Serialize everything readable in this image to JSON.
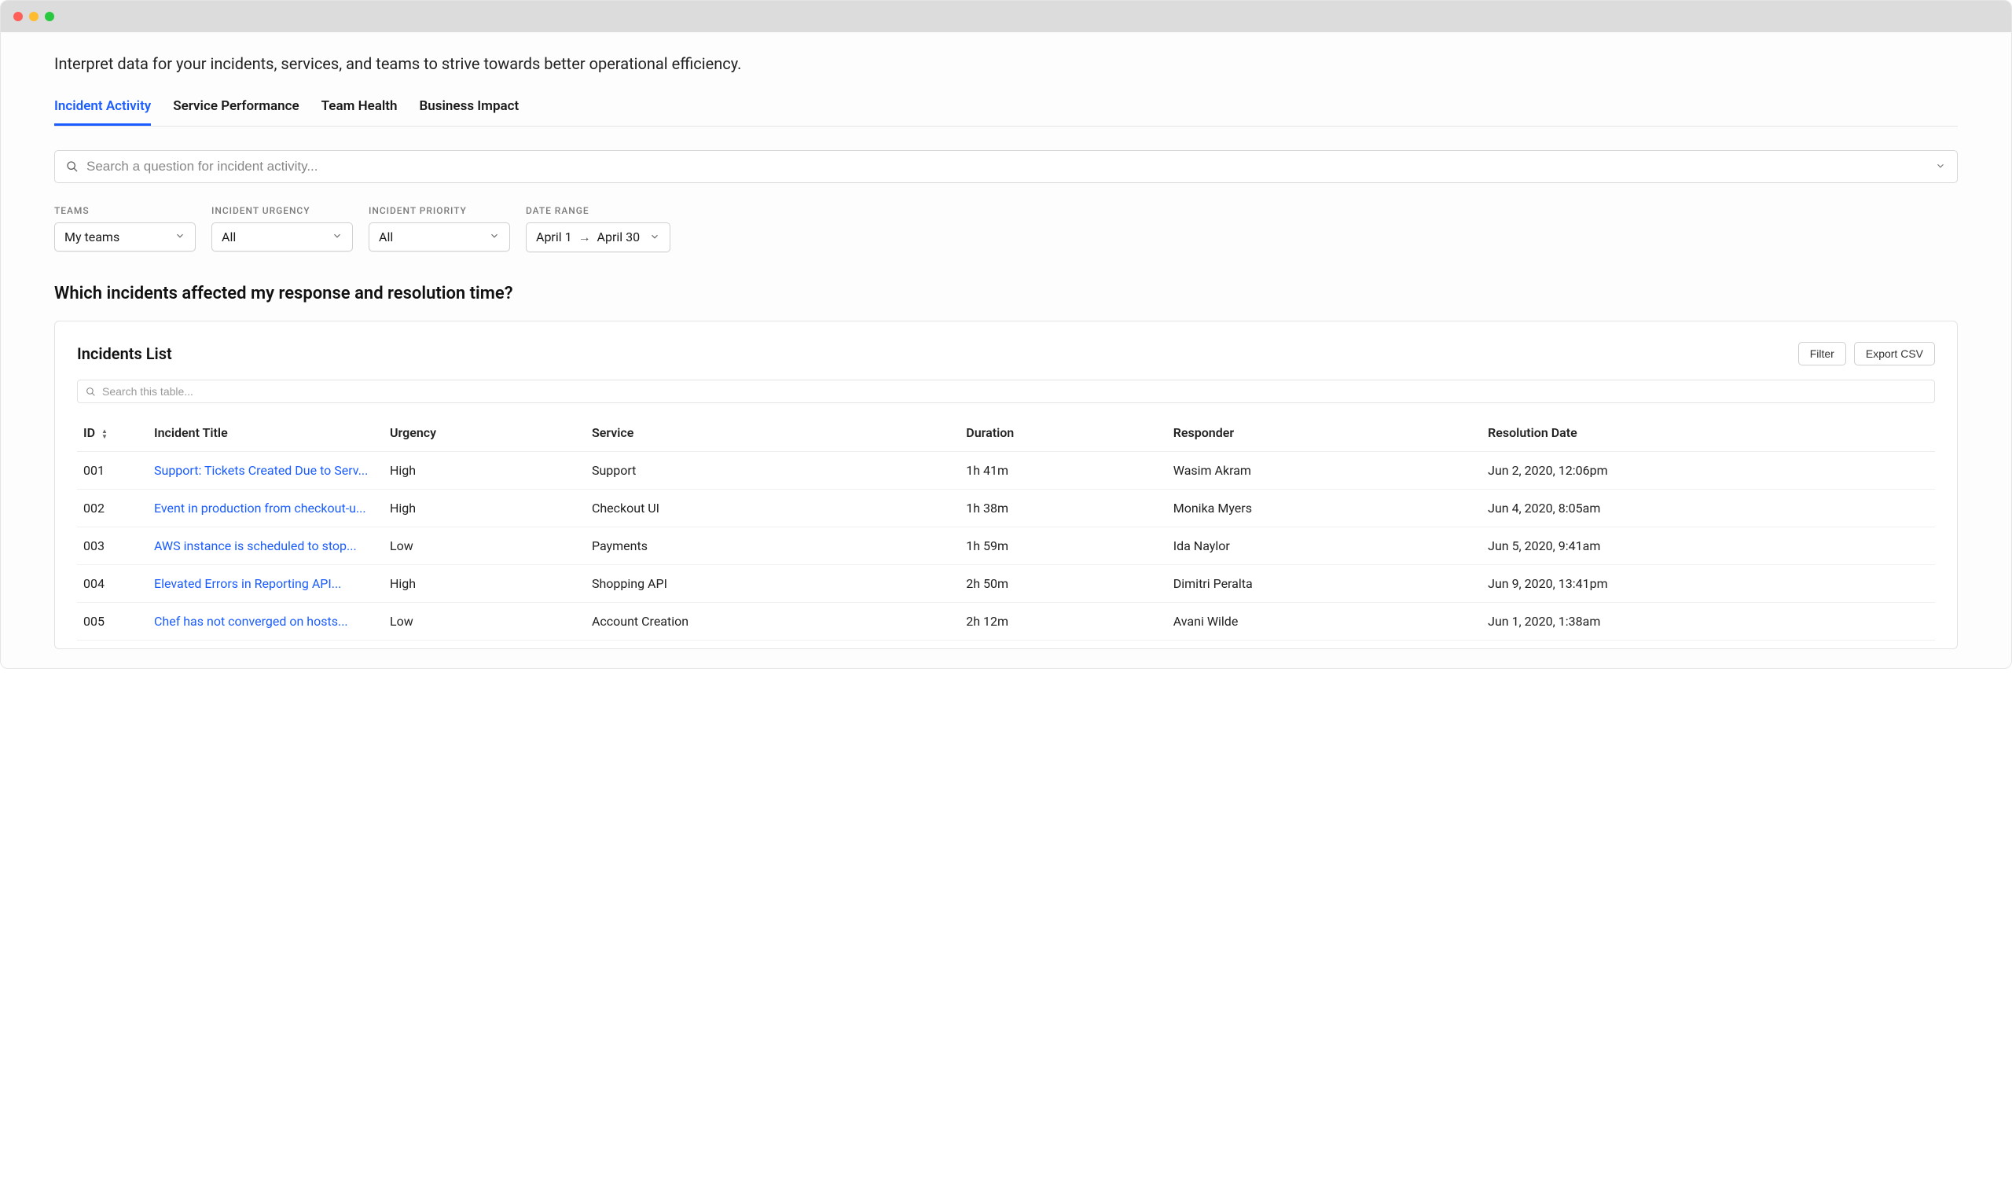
{
  "subtitle": "Interpret data for your incidents, services, and teams to strive towards better operational efficiency.",
  "tabs": [
    {
      "label": "Incident Activity",
      "active": true
    },
    {
      "label": "Service Performance",
      "active": false
    },
    {
      "label": "Team Health",
      "active": false
    },
    {
      "label": "Business Impact",
      "active": false
    }
  ],
  "search": {
    "placeholder": "Search a question for incident activity..."
  },
  "filters": {
    "teams": {
      "label": "TEAMS",
      "value": "My teams"
    },
    "urgency": {
      "label": "INCIDENT URGENCY",
      "value": "All"
    },
    "priority": {
      "label": "INCIDENT PRIORITY",
      "value": "All"
    },
    "daterange": {
      "label": "DATE RANGE",
      "from": "April 1",
      "to": "April 30"
    }
  },
  "section_title": "Which incidents affected my response and resolution time?",
  "card": {
    "title": "Incidents List",
    "filter_btn": "Filter",
    "export_btn": "Export CSV",
    "table_search_placeholder": "Search this table..."
  },
  "columns": {
    "id": "ID",
    "title": "Incident Title",
    "urgency": "Urgency",
    "service": "Service",
    "duration": "Duration",
    "responder": "Responder",
    "resolution": "Resolution Date"
  },
  "rows": [
    {
      "id": "001",
      "title": "Support: Tickets Created Due to Serv...",
      "urgency": "High",
      "service": "Support",
      "duration": "1h 41m",
      "responder": "Wasim Akram",
      "resolution": "Jun 2, 2020, 12:06pm"
    },
    {
      "id": "002",
      "title": "Event in production from checkout-u...",
      "urgency": "High",
      "service": "Checkout UI",
      "duration": "1h 38m",
      "responder": "Monika Myers",
      "resolution": "Jun 4, 2020, 8:05am"
    },
    {
      "id": "003",
      "title": "AWS instance is scheduled to stop...",
      "urgency": "Low",
      "service": "Payments",
      "duration": "1h 59m",
      "responder": "Ida Naylor",
      "resolution": "Jun 5, 2020, 9:41am"
    },
    {
      "id": "004",
      "title": "Elevated Errors in Reporting API...",
      "urgency": "High",
      "service": "Shopping API",
      "duration": "2h 50m",
      "responder": "Dimitri Peralta",
      "resolution": "Jun 9, 2020, 13:41pm"
    },
    {
      "id": "005",
      "title": "Chef has not converged on hosts...",
      "urgency": "Low",
      "service": "Account Creation",
      "duration": "2h 12m",
      "responder": "Avani Wilde",
      "resolution": "Jun 1, 2020, 1:38am"
    }
  ]
}
